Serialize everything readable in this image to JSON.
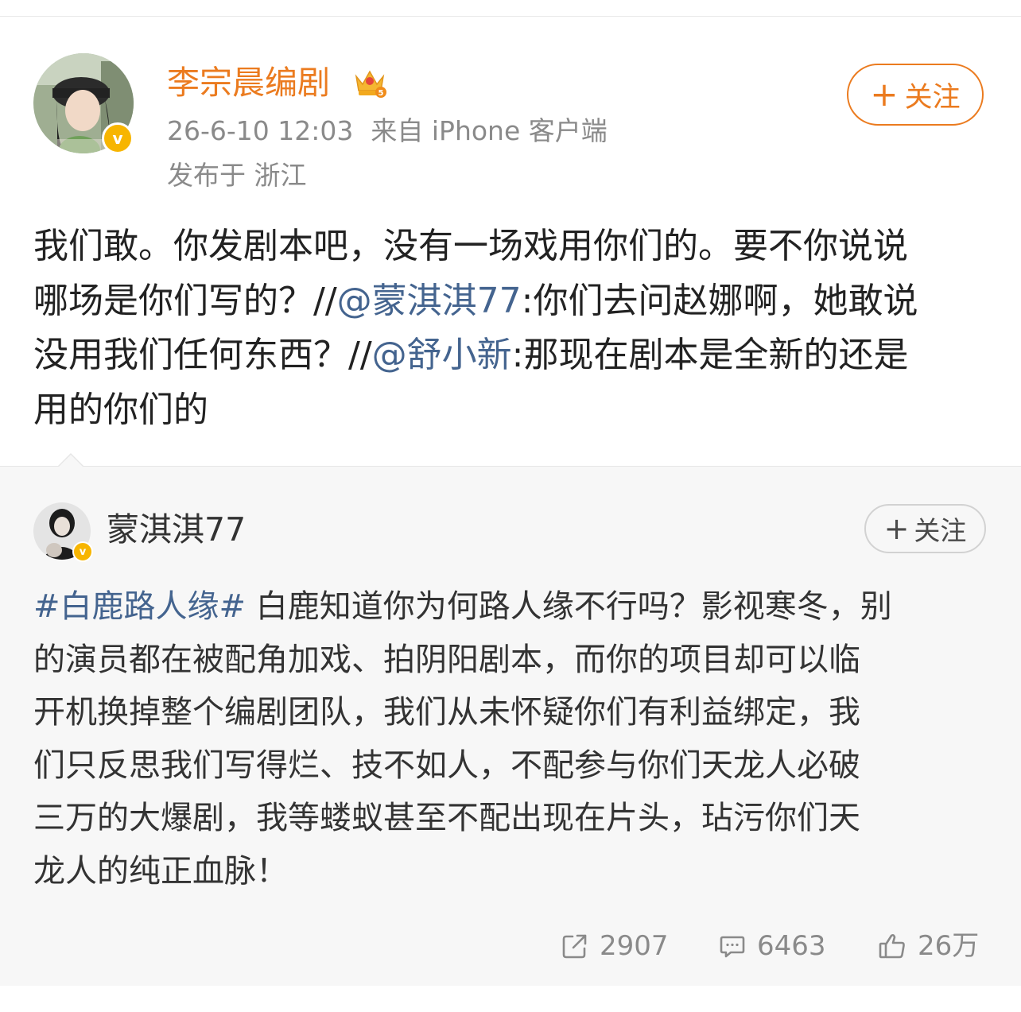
{
  "post": {
    "author": "李宗晨编剧",
    "time": "26-6-10 12:03",
    "source": "来自 iPhone 客户端",
    "location": "发布于 浙江",
    "follow_label": "关注",
    "content": {
      "l1": "我们敢。你发剧本吧，没有一场戏用你们的。要不你说说",
      "l2a": "哪场是你们写的？//",
      "l2b": "@蒙淇淇77",
      "l2c": ":你们去问赵娜啊，她敢说",
      "l3a": "没用我们任何东西？//",
      "l3b": "@舒小新",
      "l3c": ":那现在剧本是全新的还是",
      "l4": "用的你们的"
    }
  },
  "retweet": {
    "author": "蒙淇淇77",
    "follow_label": "关注",
    "content": {
      "l1a": "#白鹿路人缘#",
      "l1b": " 白鹿知道你为何路人缘不行吗？影视寒冬，别",
      "l2": "的演员都在被配角加戏、拍阴阳剧本，而你的项目却可以临",
      "l3": "开机换掉整个编剧团队，我们从未怀疑你们有利益绑定，我",
      "l4": "们只反思我们写得烂、技不如人，不配参与你们天龙人必破",
      "l5": "三万的大爆剧，我等蝼蚁甚至不配出现在片头，玷污你们天",
      "l6": "龙人的纯正血脉！"
    },
    "stats": {
      "reposts": "2907",
      "comments": "6463",
      "likes": "26万"
    }
  },
  "icons": [
    "verified-badge-icon",
    "crown-level-icon",
    "repost-icon",
    "comment-icon",
    "like-icon"
  ],
  "colors": {
    "accent": "#eb7b1f",
    "link": "#44648f",
    "muted": "#8a8a8a",
    "verified": "#f7b500"
  }
}
